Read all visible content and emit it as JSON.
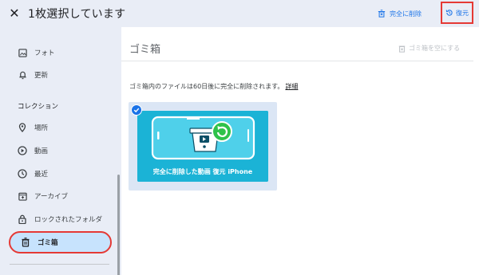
{
  "topbar": {
    "close_icon": "close-icon",
    "title": "1枚選択しています",
    "delete_label": "完全に削除",
    "restore_label": "復元"
  },
  "sidebar": {
    "items_top": [
      {
        "label": "フォト",
        "icon": "photo-icon"
      },
      {
        "label": "更新",
        "icon": "bell-icon"
      }
    ],
    "section_title": "コレクション",
    "items": [
      {
        "label": "場所",
        "icon": "location-pin-icon"
      },
      {
        "label": "動画",
        "icon": "play-circle-icon"
      },
      {
        "label": "最近",
        "icon": "clock-icon"
      },
      {
        "label": "アーカイブ",
        "icon": "archive-icon"
      },
      {
        "label": "ロックされたフォルダ",
        "icon": "lock-icon"
      },
      {
        "label": "ゴミ箱",
        "icon": "trash-icon",
        "active": true
      }
    ]
  },
  "main": {
    "title": "ゴミ箱",
    "empty_trash_label": "ゴミ箱を空にする",
    "info_text": "ゴミ箱内のファイルは60日後に完全に削除されます。",
    "info_link": "詳細",
    "thumbnail": {
      "caption": "完全に削除した動画 復元 iPhone",
      "selected": true
    }
  },
  "colors": {
    "accent": "#1a73e8",
    "highlight_border": "#e53935",
    "sidebar_bg": "#e9edf6",
    "active_item_bg": "#c7e3fd",
    "thumbnail_bg": "#1bb3d6"
  }
}
